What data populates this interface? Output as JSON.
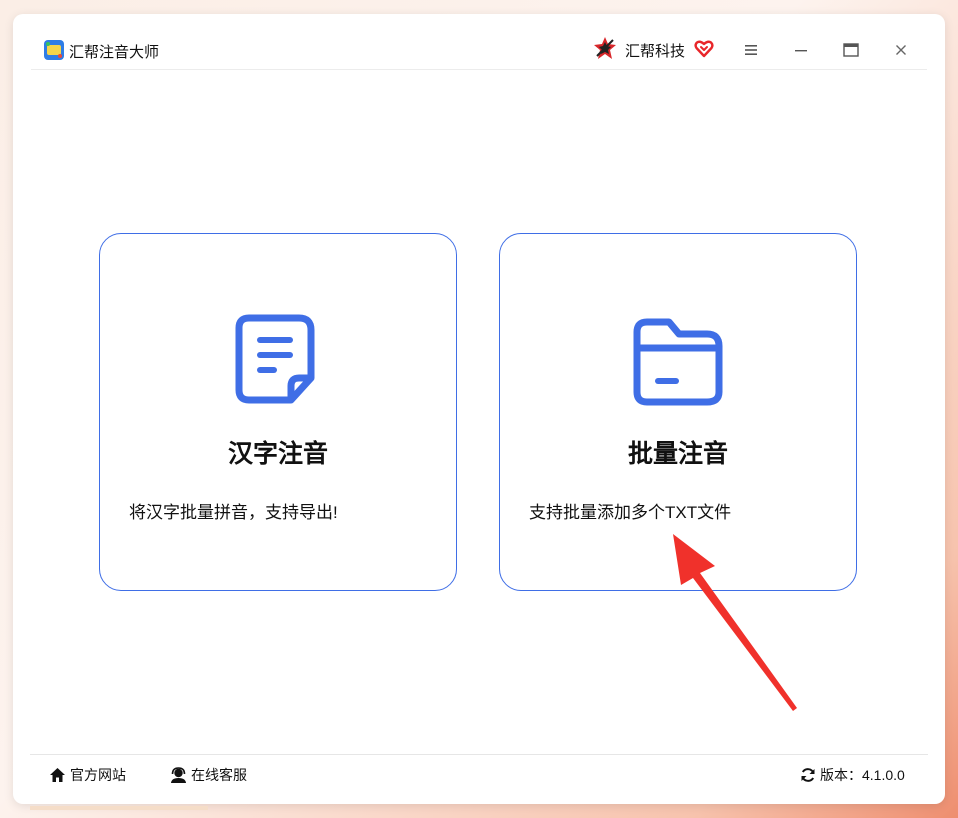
{
  "window": {
    "app_title": "汇帮注音大师",
    "brand_name": "汇帮科技",
    "controls": {
      "menu": "menu-icon",
      "minimize": "minimize-icon",
      "maximize": "maximize-icon",
      "close": "close-icon"
    }
  },
  "cards": [
    {
      "title": "汉字注音",
      "description": "将汉字批量拼音，支持导出!",
      "icon": "document-icon"
    },
    {
      "title": "批量注音",
      "description": "支持批量添加多个TXT文件",
      "icon": "folder-icon"
    }
  ],
  "footer": {
    "website_label": "官方网站",
    "support_label": "在线客服",
    "version_label": "版本：4.1.0.0"
  },
  "colors": {
    "accent": "#3f6ee6",
    "annotation_arrow": "#f0312b",
    "heart": "#e8262a"
  }
}
